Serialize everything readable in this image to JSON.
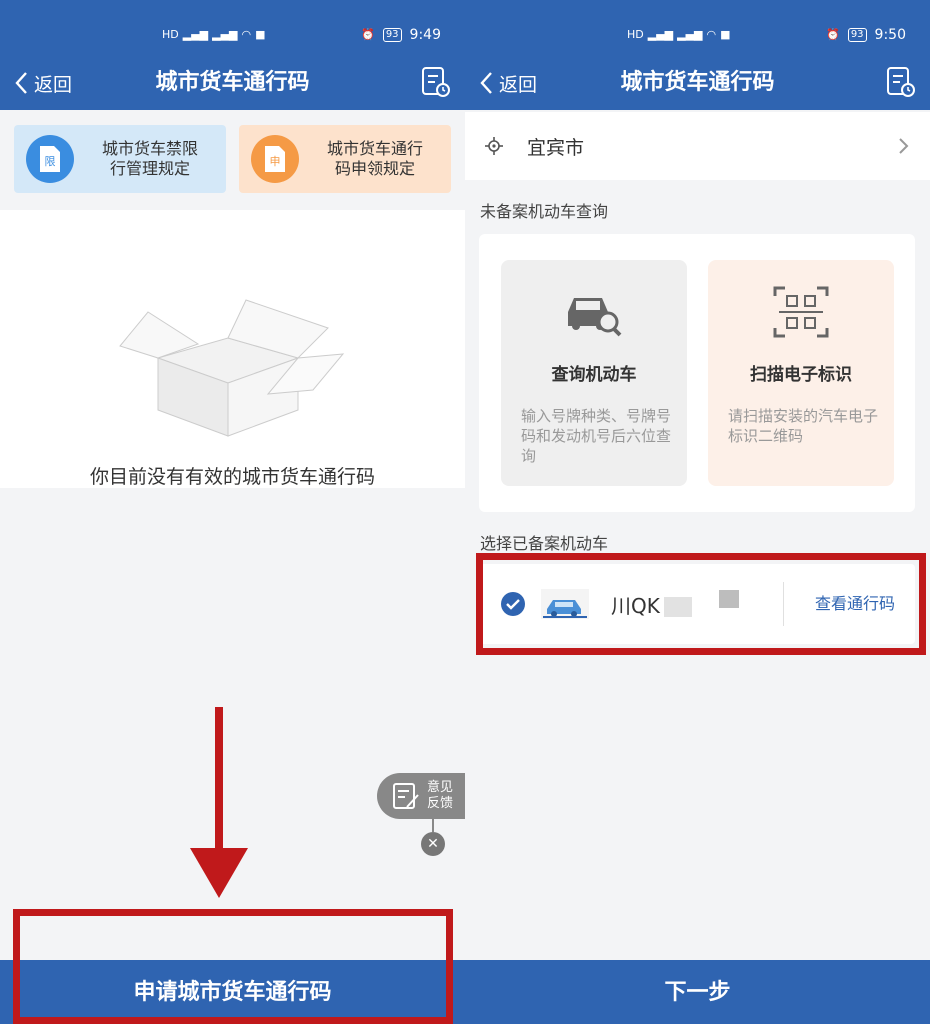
{
  "left": {
    "status": {
      "time": "9:49",
      "battery": "93"
    },
    "header": {
      "back_label": "返回",
      "title": "城市货车通行码"
    },
    "cards": [
      {
        "badge": "限",
        "label_line1": "城市货车禁限",
        "label_line2": "行管理规定"
      },
      {
        "badge": "申",
        "label_line1": "城市货车通行",
        "label_line2": "码申领规定"
      }
    ],
    "empty_text": "你目前没有有效的城市货车通行码",
    "feedback": {
      "line1": "意见",
      "line2": "反馈",
      "close": "✕"
    },
    "bottom_button": "申请城市货车通行码"
  },
  "right": {
    "status": {
      "time": "9:50",
      "battery": "93"
    },
    "header": {
      "back_label": "返回",
      "title": "城市货车通行码"
    },
    "city": "宜宾市",
    "section_unregistered": "未备案机动车查询",
    "query_cards": [
      {
        "title": "查询机动车",
        "desc": "输入号牌种类、号牌号码和发动机号后六位查询"
      },
      {
        "title": "扫描电子标识",
        "desc": "请扫描安装的汽车电子标识二维码"
      }
    ],
    "section_registered": "选择已备案机动车",
    "vehicle": {
      "plate": "川QK",
      "link": "查看通行码"
    },
    "bottom_button": "下一步"
  },
  "colors": {
    "primary": "#2f64b1",
    "highlight_red": "#c0191b",
    "card_blue": "#d4e8f8",
    "card_orange": "#fde2cc"
  },
  "icons": [
    "chevron-left-icon",
    "document-clock-icon",
    "box-icon",
    "locate-icon",
    "chevron-right-icon",
    "car-search-icon",
    "qr-scan-icon",
    "check-circle-icon",
    "car-icon",
    "feedback-icon"
  ]
}
